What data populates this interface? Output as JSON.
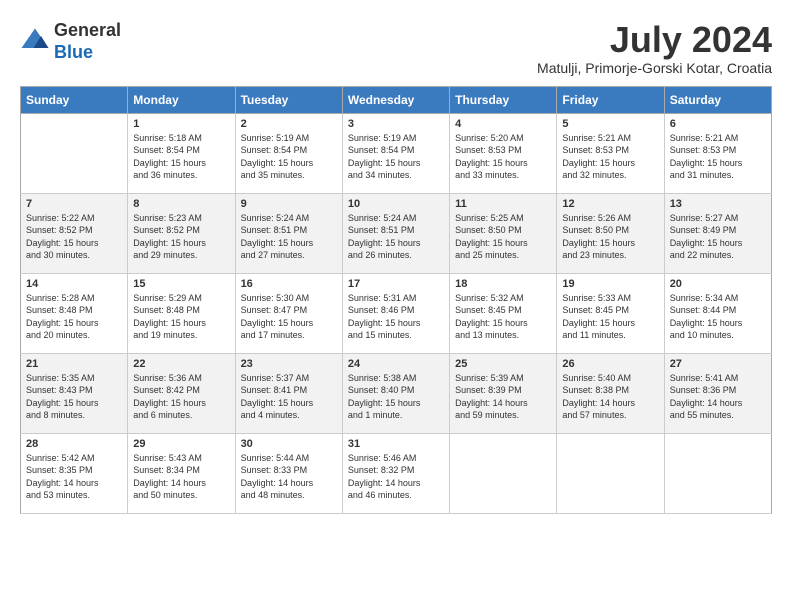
{
  "header": {
    "logo_general": "General",
    "logo_blue": "Blue",
    "month_year": "July 2024",
    "location": "Matulji, Primorje-Gorski Kotar, Croatia"
  },
  "columns": [
    "Sunday",
    "Monday",
    "Tuesday",
    "Wednesday",
    "Thursday",
    "Friday",
    "Saturday"
  ],
  "weeks": [
    [
      {
        "day": "",
        "info": ""
      },
      {
        "day": "1",
        "info": "Sunrise: 5:18 AM\nSunset: 8:54 PM\nDaylight: 15 hours\nand 36 minutes."
      },
      {
        "day": "2",
        "info": "Sunrise: 5:19 AM\nSunset: 8:54 PM\nDaylight: 15 hours\nand 35 minutes."
      },
      {
        "day": "3",
        "info": "Sunrise: 5:19 AM\nSunset: 8:54 PM\nDaylight: 15 hours\nand 34 minutes."
      },
      {
        "day": "4",
        "info": "Sunrise: 5:20 AM\nSunset: 8:53 PM\nDaylight: 15 hours\nand 33 minutes."
      },
      {
        "day": "5",
        "info": "Sunrise: 5:21 AM\nSunset: 8:53 PM\nDaylight: 15 hours\nand 32 minutes."
      },
      {
        "day": "6",
        "info": "Sunrise: 5:21 AM\nSunset: 8:53 PM\nDaylight: 15 hours\nand 31 minutes."
      }
    ],
    [
      {
        "day": "7",
        "info": "Sunrise: 5:22 AM\nSunset: 8:52 PM\nDaylight: 15 hours\nand 30 minutes."
      },
      {
        "day": "8",
        "info": "Sunrise: 5:23 AM\nSunset: 8:52 PM\nDaylight: 15 hours\nand 29 minutes."
      },
      {
        "day": "9",
        "info": "Sunrise: 5:24 AM\nSunset: 8:51 PM\nDaylight: 15 hours\nand 27 minutes."
      },
      {
        "day": "10",
        "info": "Sunrise: 5:24 AM\nSunset: 8:51 PM\nDaylight: 15 hours\nand 26 minutes."
      },
      {
        "day": "11",
        "info": "Sunrise: 5:25 AM\nSunset: 8:50 PM\nDaylight: 15 hours\nand 25 minutes."
      },
      {
        "day": "12",
        "info": "Sunrise: 5:26 AM\nSunset: 8:50 PM\nDaylight: 15 hours\nand 23 minutes."
      },
      {
        "day": "13",
        "info": "Sunrise: 5:27 AM\nSunset: 8:49 PM\nDaylight: 15 hours\nand 22 minutes."
      }
    ],
    [
      {
        "day": "14",
        "info": "Sunrise: 5:28 AM\nSunset: 8:48 PM\nDaylight: 15 hours\nand 20 minutes."
      },
      {
        "day": "15",
        "info": "Sunrise: 5:29 AM\nSunset: 8:48 PM\nDaylight: 15 hours\nand 19 minutes."
      },
      {
        "day": "16",
        "info": "Sunrise: 5:30 AM\nSunset: 8:47 PM\nDaylight: 15 hours\nand 17 minutes."
      },
      {
        "day": "17",
        "info": "Sunrise: 5:31 AM\nSunset: 8:46 PM\nDaylight: 15 hours\nand 15 minutes."
      },
      {
        "day": "18",
        "info": "Sunrise: 5:32 AM\nSunset: 8:45 PM\nDaylight: 15 hours\nand 13 minutes."
      },
      {
        "day": "19",
        "info": "Sunrise: 5:33 AM\nSunset: 8:45 PM\nDaylight: 15 hours\nand 11 minutes."
      },
      {
        "day": "20",
        "info": "Sunrise: 5:34 AM\nSunset: 8:44 PM\nDaylight: 15 hours\nand 10 minutes."
      }
    ],
    [
      {
        "day": "21",
        "info": "Sunrise: 5:35 AM\nSunset: 8:43 PM\nDaylight: 15 hours\nand 8 minutes."
      },
      {
        "day": "22",
        "info": "Sunrise: 5:36 AM\nSunset: 8:42 PM\nDaylight: 15 hours\nand 6 minutes."
      },
      {
        "day": "23",
        "info": "Sunrise: 5:37 AM\nSunset: 8:41 PM\nDaylight: 15 hours\nand 4 minutes."
      },
      {
        "day": "24",
        "info": "Sunrise: 5:38 AM\nSunset: 8:40 PM\nDaylight: 15 hours\nand 1 minute."
      },
      {
        "day": "25",
        "info": "Sunrise: 5:39 AM\nSunset: 8:39 PM\nDaylight: 14 hours\nand 59 minutes."
      },
      {
        "day": "26",
        "info": "Sunrise: 5:40 AM\nSunset: 8:38 PM\nDaylight: 14 hours\nand 57 minutes."
      },
      {
        "day": "27",
        "info": "Sunrise: 5:41 AM\nSunset: 8:36 PM\nDaylight: 14 hours\nand 55 minutes."
      }
    ],
    [
      {
        "day": "28",
        "info": "Sunrise: 5:42 AM\nSunset: 8:35 PM\nDaylight: 14 hours\nand 53 minutes."
      },
      {
        "day": "29",
        "info": "Sunrise: 5:43 AM\nSunset: 8:34 PM\nDaylight: 14 hours\nand 50 minutes."
      },
      {
        "day": "30",
        "info": "Sunrise: 5:44 AM\nSunset: 8:33 PM\nDaylight: 14 hours\nand 48 minutes."
      },
      {
        "day": "31",
        "info": "Sunrise: 5:46 AM\nSunset: 8:32 PM\nDaylight: 14 hours\nand 46 minutes."
      },
      {
        "day": "",
        "info": ""
      },
      {
        "day": "",
        "info": ""
      },
      {
        "day": "",
        "info": ""
      }
    ]
  ]
}
